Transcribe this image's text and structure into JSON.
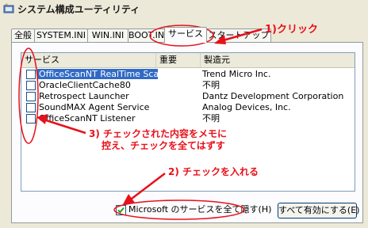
{
  "window": {
    "title": "システム構成ユーティリティ"
  },
  "tabs": [
    {
      "label": "全般"
    },
    {
      "label": "SYSTEM.INI"
    },
    {
      "label": "WIN.INI"
    },
    {
      "label": "BOOT.INI"
    },
    {
      "label": "サービス"
    },
    {
      "label": "スタートアップ"
    }
  ],
  "list": {
    "columns": [
      {
        "label": "サービス"
      },
      {
        "label": "重要"
      },
      {
        "label": "製造元"
      }
    ],
    "rows": [
      {
        "name": "OfficeScanNT RealTime Scan",
        "essential": "",
        "manufacturer": "Trend Micro Inc.",
        "checked": false,
        "selected": true
      },
      {
        "name": "OracleClientCache80",
        "essential": "",
        "manufacturer": "不明",
        "checked": false,
        "selected": false
      },
      {
        "name": "Retrospect Launcher",
        "essential": "",
        "manufacturer": "Dantz Development Corporation",
        "checked": false,
        "selected": false
      },
      {
        "name": "SoundMAX Agent Service",
        "essential": "",
        "manufacturer": "Analog Devices, Inc.",
        "checked": false,
        "selected": false
      },
      {
        "name": "OfficeScanNT Listener",
        "essential": "",
        "manufacturer": "不明",
        "checked": false,
        "selected": false
      }
    ]
  },
  "hide_ms_checkbox": {
    "label": "Microsoft のサービスを全て隠す(H)",
    "checked": true
  },
  "enable_all_button": {
    "label": "すべて有効にする(E)"
  },
  "annotations": {
    "step1": "1)クリック",
    "step2": "2) チェックを入れる",
    "step3_line1": "3) チェックされた内容をメモに",
    "step3_line2": "控え、チェックを全てはずす"
  },
  "colors": {
    "annotation": "#e8101a",
    "selection": "#316ac5",
    "window_bg": "#ece9d8"
  }
}
